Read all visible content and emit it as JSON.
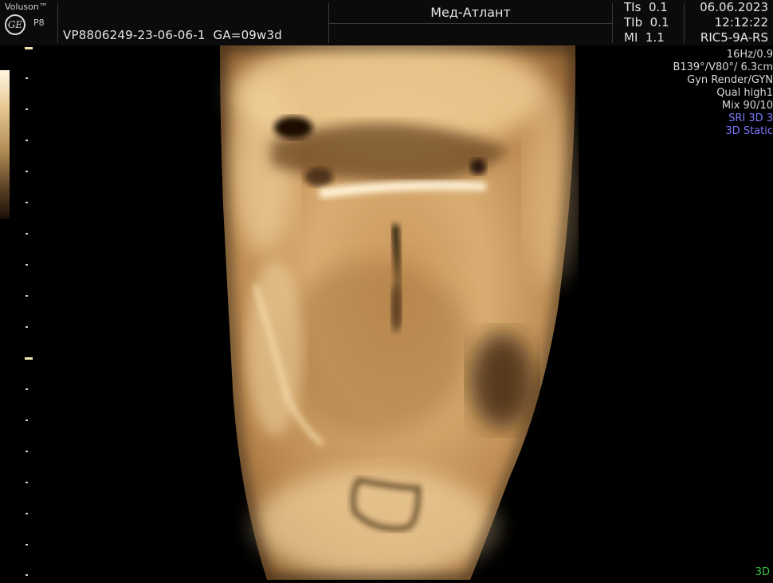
{
  "header": {
    "brand": "Voluson™",
    "logo": "GE",
    "model": "P8",
    "patient_id": "VP8806249-23-06-06-1",
    "gestational_age": "GA=09w3d",
    "clinic": "Мед-Атлант",
    "safety": {
      "tis": "TIs  0.1",
      "tib": "TIb  0.1",
      "mi": "MI  1.1"
    },
    "date": "06.06.2023",
    "time": "12:12:22",
    "probe": "RIC5-9A-RS"
  },
  "info_panel": {
    "line1": "16Hz/0.9",
    "line2": "B139°/V80°/ 6.3cm",
    "line3": "Gyn Render/GYN",
    "line4": "Qual high1",
    "line5": "Mix 90/10",
    "line6": "SRI 3D 3",
    "line7": "3D Static",
    "highlight_color": "#7a7aff"
  },
  "mode_indicator": "3D",
  "colors": {
    "background": "#000000",
    "tissue_light": "#f4d3a0",
    "tissue_dark": "#6b4522",
    "mode_green": "#3ec24a"
  },
  "scan_icons": {
    "render": "ultrasound-3d-render-image",
    "gray_map": "gray-map-bar"
  }
}
